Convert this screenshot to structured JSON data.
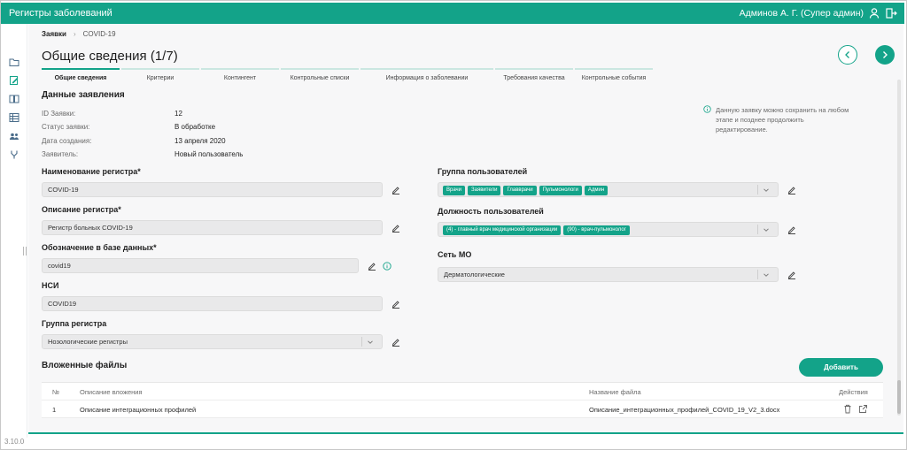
{
  "header": {
    "app_title": "Регистры заболеваний",
    "user": "Админов А. Г. (Супер админ)",
    "icons": [
      "user-icon",
      "logout-icon"
    ]
  },
  "sidebar": {
    "icons": [
      "folder-icon",
      "edit-document-icon",
      "book-icon",
      "table-icon",
      "users-icon",
      "flow-icon"
    ],
    "version": "3.10.0"
  },
  "breadcrumb": {
    "root": "Заявки",
    "current": "COVID-19"
  },
  "page_title": "Общие сведения (1/7)",
  "steps": [
    "Общие сведения",
    "Критерии",
    "Контингент",
    "Контрольные списки",
    "Информация о заболевании",
    "Требования качества",
    "Контрольные события"
  ],
  "request": {
    "section_title": "Данные заявления",
    "rows": [
      {
        "label": "ID Заявки:",
        "value": "12"
      },
      {
        "label": "Статус заявки:",
        "value": "В обработке"
      },
      {
        "label": "Дата создания:",
        "value": "13 апреля 2020"
      },
      {
        "label": "Заявитель:",
        "value": "Новый пользователь"
      }
    ]
  },
  "info_note": "Данную заявку можно сохранить на любом этапе и позднее продолжить редактирование.",
  "form": {
    "register_name": {
      "label": "Наименование регистра*",
      "value": "COVID-19"
    },
    "register_desc": {
      "label": "Описание регистра*",
      "value": "Регистр больных COVID-19"
    },
    "db_name": {
      "label": "Обозначение в базе данных*",
      "value": "covid19"
    },
    "nsi": {
      "label": "НСИ",
      "value": "COVID19"
    },
    "register_group": {
      "label": "Группа регистра",
      "value": "Нозологические регистры"
    },
    "user_group": {
      "label": "Группа пользователей",
      "chips": [
        "Врачи",
        "Заявители",
        "Главврачи",
        "Пульмонологи",
        "Админ"
      ]
    },
    "user_position": {
      "label": "Должность пользователей",
      "chips": [
        "(4) - главный врач медицинской организации",
        "(90) - врач-пульмонолог"
      ]
    },
    "mo_network": {
      "label": "Сеть МО",
      "value": "Дерматологические"
    }
  },
  "files": {
    "section_title": "Вложенные файлы",
    "add_label": "Добавить",
    "columns": [
      "№",
      "Описание вложения",
      "Название файла",
      "Действия"
    ],
    "rows": [
      {
        "num": "1",
        "desc": "Описание интеграционных профилей",
        "file": "Описание_интеграционных_профилей_COVID_19_V2_3.docx"
      }
    ]
  },
  "colors": {
    "accent": "#13a389",
    "step_inactive": "#cbe7e1"
  }
}
